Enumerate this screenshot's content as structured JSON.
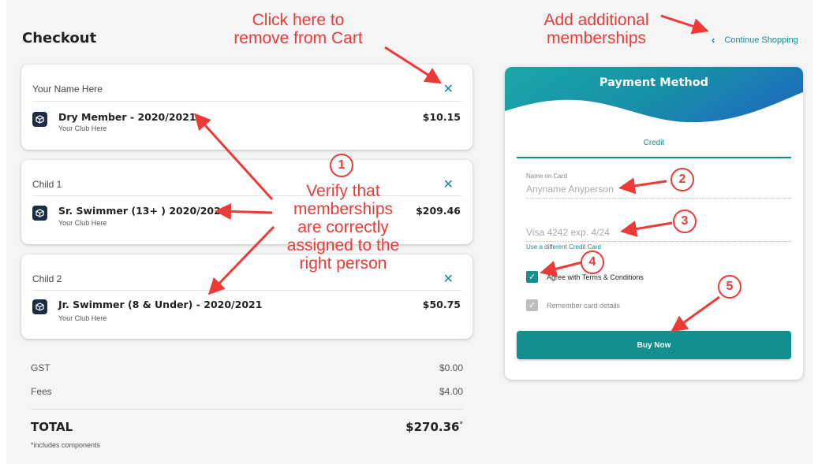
{
  "page": {
    "title": "Checkout"
  },
  "nav": {
    "continue_label": "Continue Shopping"
  },
  "cart": [
    {
      "person": "Your Name Here",
      "item": "Dry Member - 2020/2021",
      "club": "Your Club Here",
      "price": "$10.15"
    },
    {
      "person": "Child 1",
      "item": "Sr. Swimmer (13+ ) 2020/2021",
      "club": "Your Club Here",
      "price": "$209.46"
    },
    {
      "person": "Child 2",
      "item": "Jr. Swimmer (8 & Under) - 2020/2021",
      "club": "Your Club Here",
      "price": "$50.75"
    }
  ],
  "summary": {
    "gst_label": "GST",
    "gst_value": "$0.00",
    "fees_label": "Fees",
    "fees_value": "$4.00",
    "total_label": "TOTAL",
    "total_value": "$270.36",
    "total_marker": "*",
    "note": "*includes components"
  },
  "payment": {
    "title": "Payment Method",
    "tab": "Credit",
    "name_label": "Name on Card",
    "name_placeholder": "Anyname Anyperson",
    "card_placeholder": "Visa 4242 exp. 4/24",
    "use_different": "Use a different Credit Card",
    "agree_label": "Agree with Terms & Conditions",
    "remember_label": "Remember card details",
    "buy_label": "Buy Now"
  },
  "annotations": {
    "remove_from_cart": "Click here to\nremove from Cart",
    "add_memberships": "Add additional\nmemberships",
    "verify": "Verify that\nmemberships\nare correctly\nassigned to the\nright person",
    "num1": "1",
    "num2": "2",
    "num3": "3",
    "num4": "4",
    "num5": "5"
  },
  "colors": {
    "accent": "#138f8f",
    "annotation": "#ee3a36",
    "icon_bg": "#1b2c45"
  },
  "icons": {
    "remove": "close-icon",
    "item": "package-icon",
    "back": "chevron-left-icon",
    "check": "check-icon"
  }
}
